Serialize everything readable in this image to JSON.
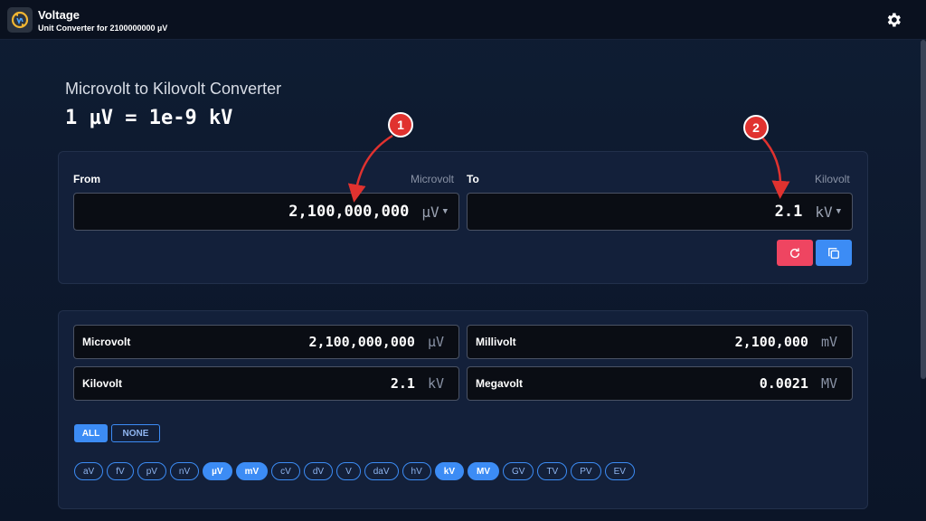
{
  "header": {
    "app_title": "Voltage",
    "subtitle": "Unit Converter for 2100000000 µV"
  },
  "page": {
    "title": "Microvolt to Kilovolt Converter",
    "formula": "1 µV = 1e-9 kV"
  },
  "converter": {
    "from": {
      "label": "From",
      "unit_name": "Microvolt",
      "value": "2,100,000,000",
      "unit_symbol": "µV"
    },
    "to": {
      "label": "To",
      "unit_name": "Kilovolt",
      "value": "2.1",
      "unit_symbol": "kV"
    }
  },
  "results": [
    {
      "name": "Microvolt",
      "value": "2,100,000,000",
      "unit": "µV"
    },
    {
      "name": "Millivolt",
      "value": "2,100,000",
      "unit": "mV"
    },
    {
      "name": "Kilovolt",
      "value": "2.1",
      "unit": "kV"
    },
    {
      "name": "Megavolt",
      "value": "0.0021",
      "unit": "MV"
    }
  ],
  "filters": {
    "all_label": "ALL",
    "none_label": "NONE",
    "units": [
      {
        "label": "aV",
        "active": false
      },
      {
        "label": "fV",
        "active": false
      },
      {
        "label": "pV",
        "active": false
      },
      {
        "label": "nV",
        "active": false
      },
      {
        "label": "µV",
        "active": true
      },
      {
        "label": "mV",
        "active": true
      },
      {
        "label": "cV",
        "active": false
      },
      {
        "label": "dV",
        "active": false
      },
      {
        "label": "V",
        "active": false
      },
      {
        "label": "daV",
        "active": false
      },
      {
        "label": "hV",
        "active": false
      },
      {
        "label": "kV",
        "active": true
      },
      {
        "label": "MV",
        "active": true
      },
      {
        "label": "GV",
        "active": false
      },
      {
        "label": "TV",
        "active": false
      },
      {
        "label": "PV",
        "active": false
      },
      {
        "label": "EV",
        "active": false
      }
    ]
  },
  "annotations": [
    "1",
    "2"
  ],
  "colors": {
    "accent": "#3c8cf5",
    "danger": "#ef4561",
    "annotation": "#e0322f"
  },
  "icons": {
    "logo": "voltage-converter-logo",
    "settings": "gear-icon",
    "reset": "refresh-icon",
    "copy": "copy-icon"
  }
}
